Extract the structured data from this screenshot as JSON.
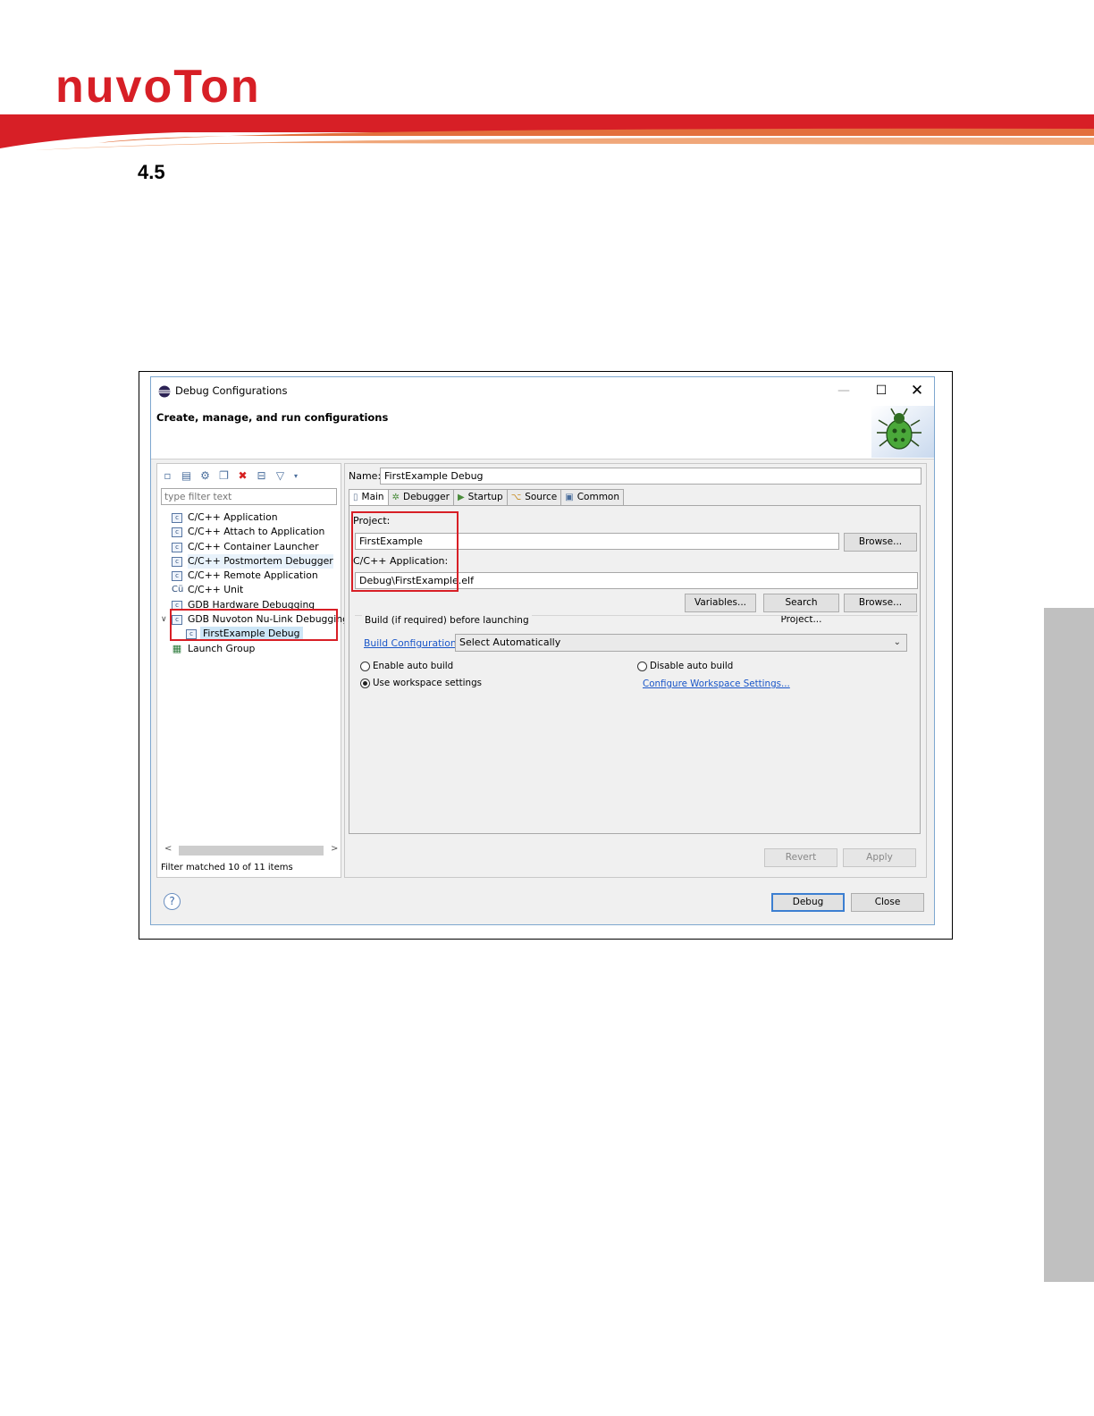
{
  "header": {
    "logo_text": "nuvoTon",
    "brand_color": "#d71f26",
    "band_colors": [
      "#d71f26",
      "#e36f3c",
      "#f0a77a"
    ],
    "section_number": "4.5"
  },
  "window": {
    "title": "Debug Configurations",
    "subtitle": "Create, manage, and run configurations",
    "controls": {
      "minimize": "—",
      "maximize": "☐",
      "close": "✕"
    },
    "banner_icon": "bug-icon"
  },
  "left_pane": {
    "toolbar_icons": [
      "new-config-icon",
      "new-prototype-icon",
      "export-icon",
      "duplicate-icon",
      "delete-icon",
      "collapse-all-icon",
      "filter-icon",
      "view-menu-icon"
    ],
    "filter_placeholder": "type filter text",
    "tree": [
      {
        "label": "C/C++ Application",
        "icon": "c-config-icon",
        "level": 0
      },
      {
        "label": "C/C++ Attach to Application",
        "icon": "c-config-icon",
        "level": 0
      },
      {
        "label": "C/C++ Container Launcher",
        "icon": "c-config-icon",
        "level": 0
      },
      {
        "label": "C/C++ Postmortem Debugger",
        "icon": "c-config-icon",
        "level": 0
      },
      {
        "label": "C/C++ Remote Application",
        "icon": "c-config-icon",
        "level": 0
      },
      {
        "label": "C/C++ Unit",
        "icon": "c-unit-icon",
        "level": 0
      },
      {
        "label": "GDB Hardware Debugging",
        "icon": "c-config-icon",
        "level": 0
      },
      {
        "label": "GDB Nuvoton Nu-Link Debugging",
        "icon": "c-config-icon",
        "level": 0,
        "expanded": true
      },
      {
        "label": "FirstExample Debug",
        "icon": "c-config-icon",
        "level": 1,
        "selected": true
      },
      {
        "label": "Launch Group",
        "icon": "launch-group-icon",
        "level": 0
      }
    ],
    "filter_status": "Filter matched 10 of 11 items"
  },
  "right_pane": {
    "name_label": "Name:",
    "name_value": "FirstExample Debug",
    "tabs": [
      {
        "label": "Main",
        "icon": "main-tab-icon",
        "active": true
      },
      {
        "label": "Debugger",
        "icon": "debugger-tab-icon"
      },
      {
        "label": "Startup",
        "icon": "startup-tab-icon"
      },
      {
        "label": "Source",
        "icon": "source-tab-icon"
      },
      {
        "label": "Common",
        "icon": "common-tab-icon"
      }
    ],
    "main": {
      "project_label": "Project:",
      "project_value": "FirstExample",
      "browse_label": "Browse...",
      "app_label": "C/C++ Application:",
      "app_value": "Debug\\FirstExample.elf",
      "variables_label": "Variables...",
      "search_project_label": "Search Project...",
      "browse2_label": "Browse...",
      "build_group_title": "Build (if required) before launching",
      "build_config_link": "Build Configuration:",
      "build_config_value": "Select Automatically",
      "enable_auto_build": "Enable auto build",
      "disable_auto_build": "Disable auto build",
      "use_workspace": "Use workspace settings",
      "configure_workspace_link": "Configure Workspace Settings..."
    },
    "revert_label": "Revert",
    "apply_label": "Apply"
  },
  "footer": {
    "help_icon": "?",
    "debug_label": "Debug",
    "close_label": "Close"
  },
  "highlight_color": "#d81f26"
}
